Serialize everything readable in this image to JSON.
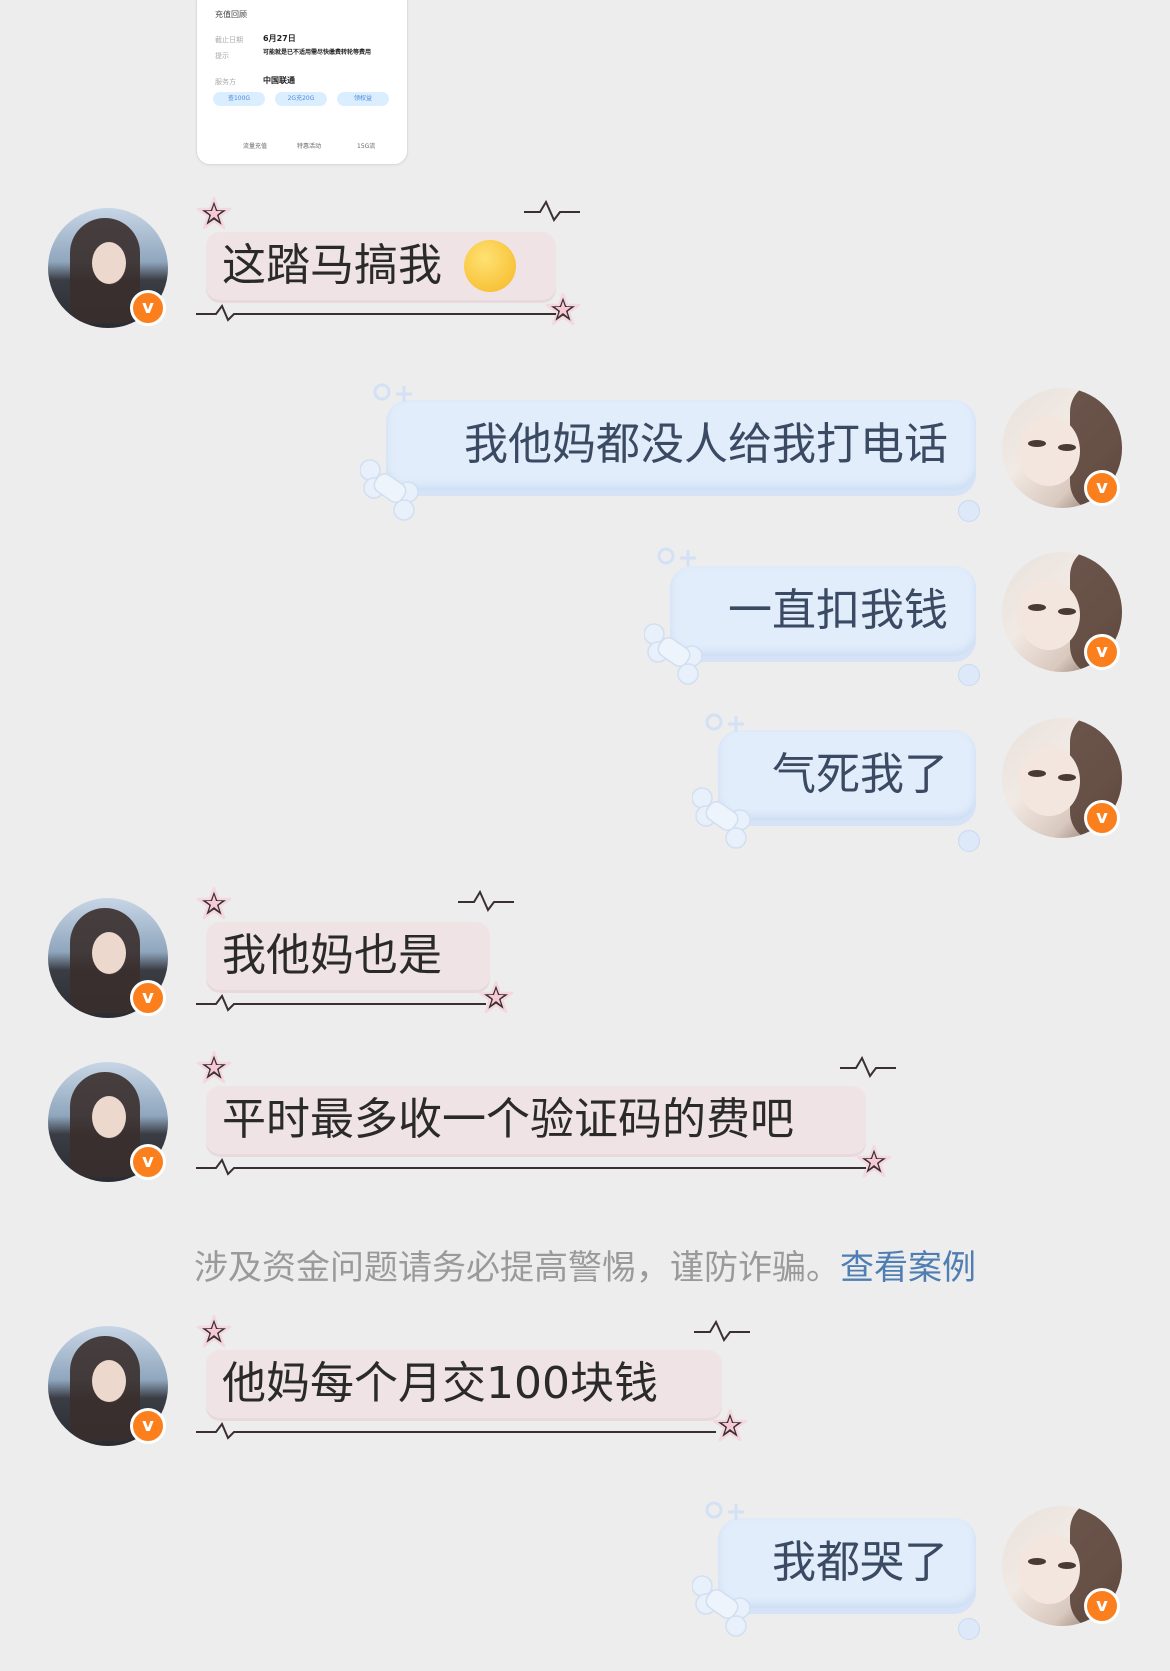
{
  "shared_card": {
    "heading": "充值回顾",
    "rows": [
      {
        "label": "截止日期",
        "value": "6月27日"
      },
      {
        "label": "提示",
        "value": "可能就是已不适用需尽快缴费转轮等费用"
      },
      {
        "label": "服务方",
        "value": "中国联通"
      }
    ],
    "chips": [
      "查100G",
      "2G充20G",
      "领权益"
    ],
    "footer": [
      "流量充值",
      "特惠活动",
      "15G流"
    ]
  },
  "messages": [
    {
      "side": "left",
      "text": "这踏马搞我",
      "emoji": "face-with-hand-emoji"
    },
    {
      "side": "right",
      "text": "我他妈都没人给我打电话"
    },
    {
      "side": "right",
      "text": "一直扣我钱"
    },
    {
      "side": "right",
      "text": "气死我了"
    },
    {
      "side": "left",
      "text": "我他妈也是"
    },
    {
      "side": "left",
      "text": "平时最多收一个验证码的费吧"
    },
    {
      "side": "left",
      "text": "他妈每个月交100块钱"
    },
    {
      "side": "right",
      "text": "我都哭了"
    }
  ],
  "notice": {
    "text": "涉及资金问题请务必提高警惕，谨防诈骗。",
    "link": "查看案例"
  },
  "badge_letter": "v",
  "colors": {
    "background": "#ededed",
    "pink_bubble": "#efe3e6",
    "blue_bubble": "#e2edfb",
    "badge": "#fb7f1d",
    "link": "#4f7eb3"
  }
}
